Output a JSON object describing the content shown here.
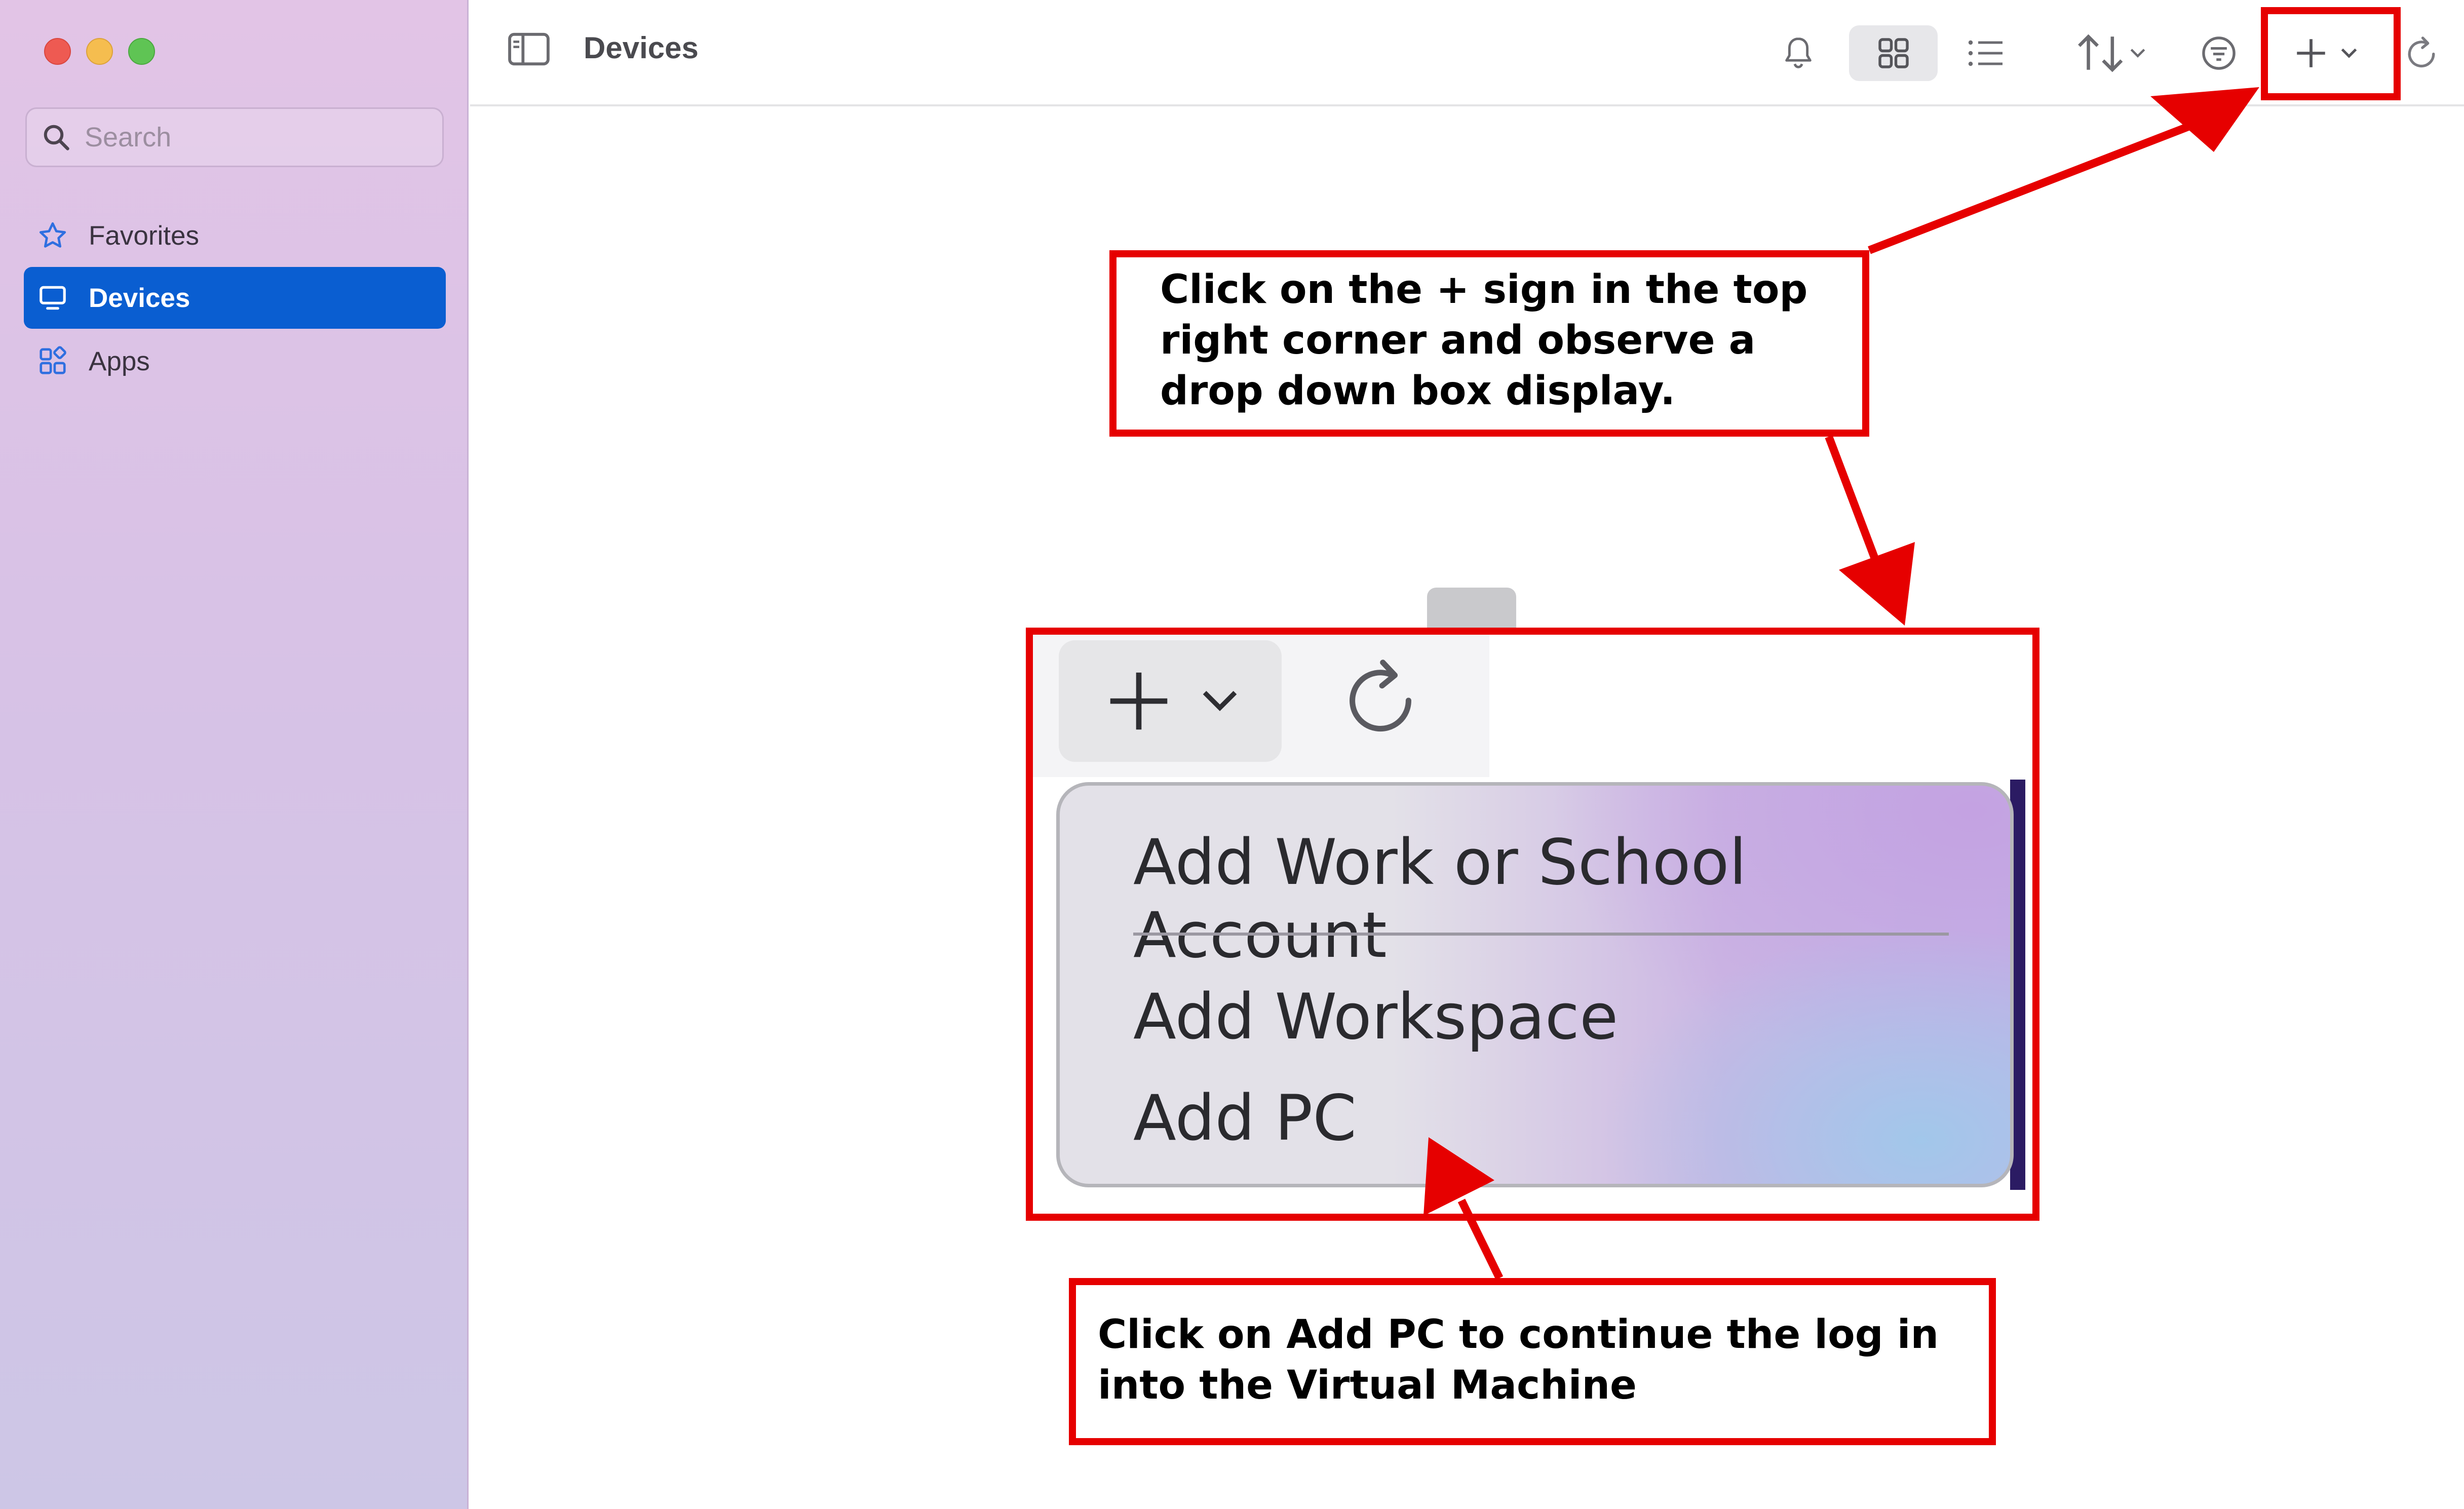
{
  "window": {
    "title": "Devices"
  },
  "sidebar": {
    "search_placeholder": "Search",
    "items": [
      {
        "label": "Favorites",
        "icon": "star-icon",
        "selected": false
      },
      {
        "label": "Devices",
        "icon": "monitor-icon",
        "selected": true
      },
      {
        "label": "Apps",
        "icon": "apps-grid-icon",
        "selected": false
      }
    ]
  },
  "toolbar": {
    "icons": [
      "sidebar-toggle-icon",
      "bell-icon",
      "grid-view-icon",
      "list-view-icon",
      "sort-icon",
      "filter-icon",
      "plus-icon",
      "chevron-down-icon",
      "refresh-icon"
    ]
  },
  "zoomed_dropdown": {
    "items": [
      "Add Work or School Account",
      "Add Workspace",
      "Add PC"
    ]
  },
  "annotations": {
    "top_callout": "Click on the + sign in the top\nright corner and observe a\ndrop down box display.",
    "bottom_callout": "Click on Add PC to continue the log in\ninto the Virtual Machine"
  },
  "colors": {
    "annotation_red": "#e60000",
    "selected_blue": "#0a5ed1",
    "close": "#ee5a52",
    "minimize": "#f5bd4f",
    "maximize": "#5fc454"
  }
}
